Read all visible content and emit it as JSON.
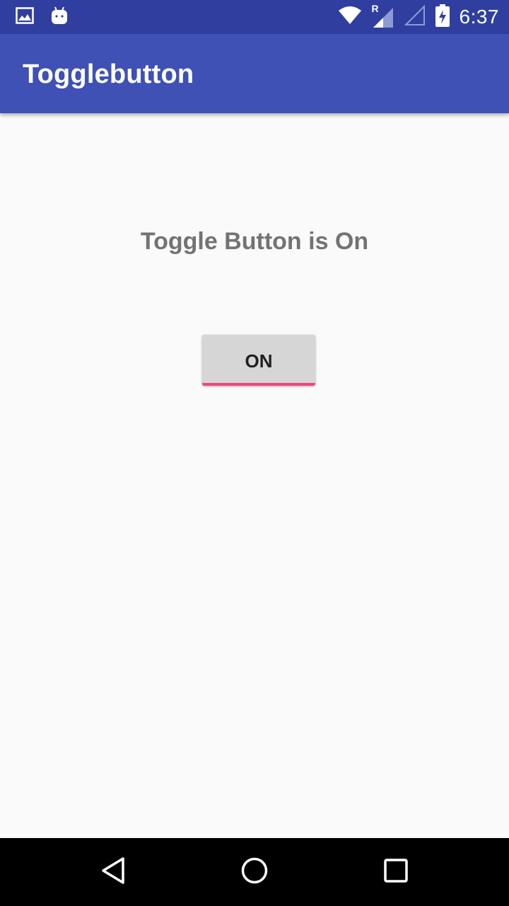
{
  "status_bar": {
    "time": "6:37",
    "network_label": "R",
    "left_icons": [
      "image-notification-icon",
      "android-notification-icon"
    ],
    "right_icons": [
      "wifi-icon",
      "signal-icon",
      "signal-empty-icon",
      "battery-charging-icon"
    ]
  },
  "app_bar": {
    "title": "Togglebutton"
  },
  "main": {
    "status_text": "Toggle Button is On",
    "toggle_button": {
      "label": "ON",
      "state": "on"
    }
  },
  "nav_bar": {
    "buttons": [
      "back-icon",
      "home-icon",
      "recents-icon"
    ]
  },
  "colors": {
    "status_bar": "#303f9f",
    "app_bar": "#3f51b5",
    "accent": "#e84a7f",
    "background": "#fafafa"
  }
}
